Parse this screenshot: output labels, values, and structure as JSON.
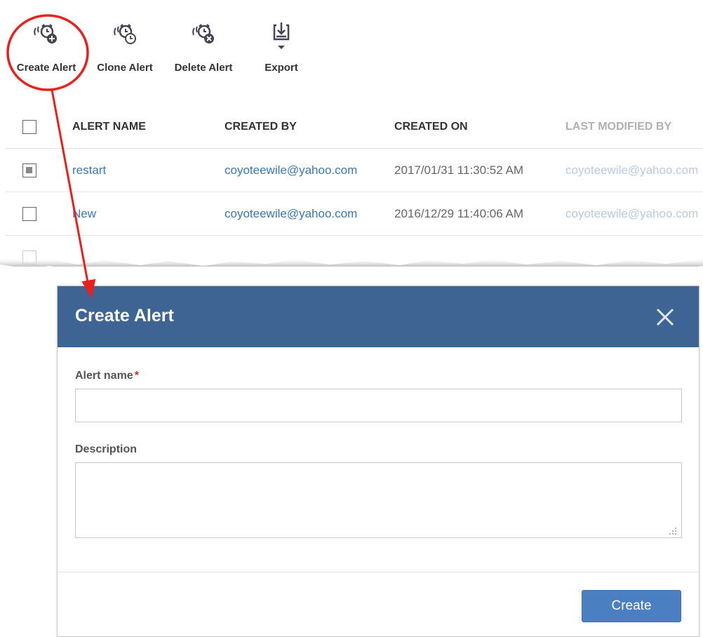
{
  "toolbar": {
    "create_label": "Create Alert",
    "clone_label": "Clone Alert",
    "delete_label": "Delete Alert",
    "export_label": "Export"
  },
  "table": {
    "columns": [
      "ALERT NAME",
      "CREATED BY",
      "CREATED ON",
      "LAST MODIFIED BY"
    ],
    "rows": [
      {
        "name": "restart",
        "created_by": "coyoteewile@yahoo.com",
        "created_on": "2017/01/31 11:30:52 AM",
        "modified_by": "coyoteewile@yahoo.com"
      },
      {
        "name": "New",
        "created_by": "coyoteewile@yahoo.com",
        "created_on": "2016/12/29 11:40:06 AM",
        "modified_by": "coyoteewile@yahoo.com"
      }
    ]
  },
  "modal": {
    "title": "Create Alert",
    "alert_name_label": "Alert name",
    "required_mark": "*",
    "description_label": "Description",
    "alert_name_value": "",
    "description_value": "",
    "create_button": "Create"
  },
  "colors": {
    "modal_header": "#3e6494",
    "primary_button": "#4a7fc1",
    "link": "#3c76b5",
    "annotation": "#e8201e"
  }
}
